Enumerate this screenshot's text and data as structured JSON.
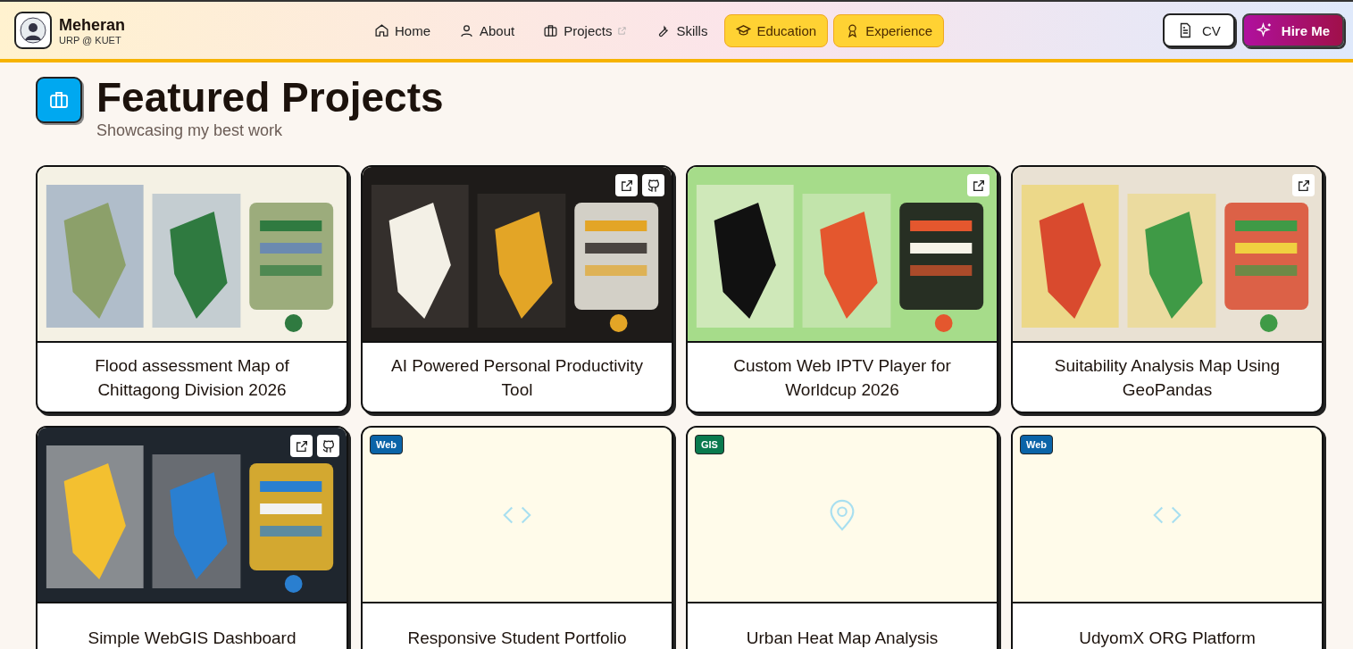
{
  "brand": {
    "name": "Meheran",
    "subtitle": "URP @ KUET"
  },
  "nav": [
    {
      "label": "Home",
      "highlighted": false,
      "external": false
    },
    {
      "label": "About",
      "highlighted": false,
      "external": false
    },
    {
      "label": "Projects",
      "highlighted": false,
      "external": true
    },
    {
      "label": "Skills",
      "highlighted": false,
      "external": false
    },
    {
      "label": "Education",
      "highlighted": true,
      "external": false
    },
    {
      "label": "Experience",
      "highlighted": true,
      "external": false
    }
  ],
  "actions": [
    {
      "label": "CV",
      "kind": "outline"
    },
    {
      "label": "Hire Me",
      "kind": "primary"
    }
  ],
  "section": {
    "title": "Featured Projects",
    "subtitle": "Showcasing my best work"
  },
  "projects": [
    {
      "title": "Flood assessment Map of Chittagong Division 2026",
      "kind": "picture",
      "link": false,
      "github": false
    },
    {
      "title": "AI Powered Personal Productivity Tool",
      "kind": "picture",
      "link": true,
      "github": true
    },
    {
      "title": "Custom Web IPTV Player for Worldcup 2026",
      "kind": "picture",
      "link": true,
      "github": false
    },
    {
      "title": "Suitability Analysis Map Using GeoPandas",
      "kind": "picture",
      "link": true,
      "github": false
    },
    {
      "title": "Simple WebGIS Dashboard",
      "kind": "picture",
      "link": true,
      "github": true
    },
    {
      "title": "Responsive Student Portfolio",
      "kind": "code",
      "tag": "Web",
      "color": "#0b64a8",
      "link": false,
      "github": false
    },
    {
      "title": "Urban Heat Map Analysis",
      "kind": "pin",
      "tag": "GIS",
      "color": "#0a7a4e",
      "link": false,
      "github": false
    },
    {
      "title": "UdyomX ORG Platform",
      "kind": "code",
      "tag": "Web",
      "color": "#0b64a8",
      "link": false,
      "github": false
    }
  ]
}
